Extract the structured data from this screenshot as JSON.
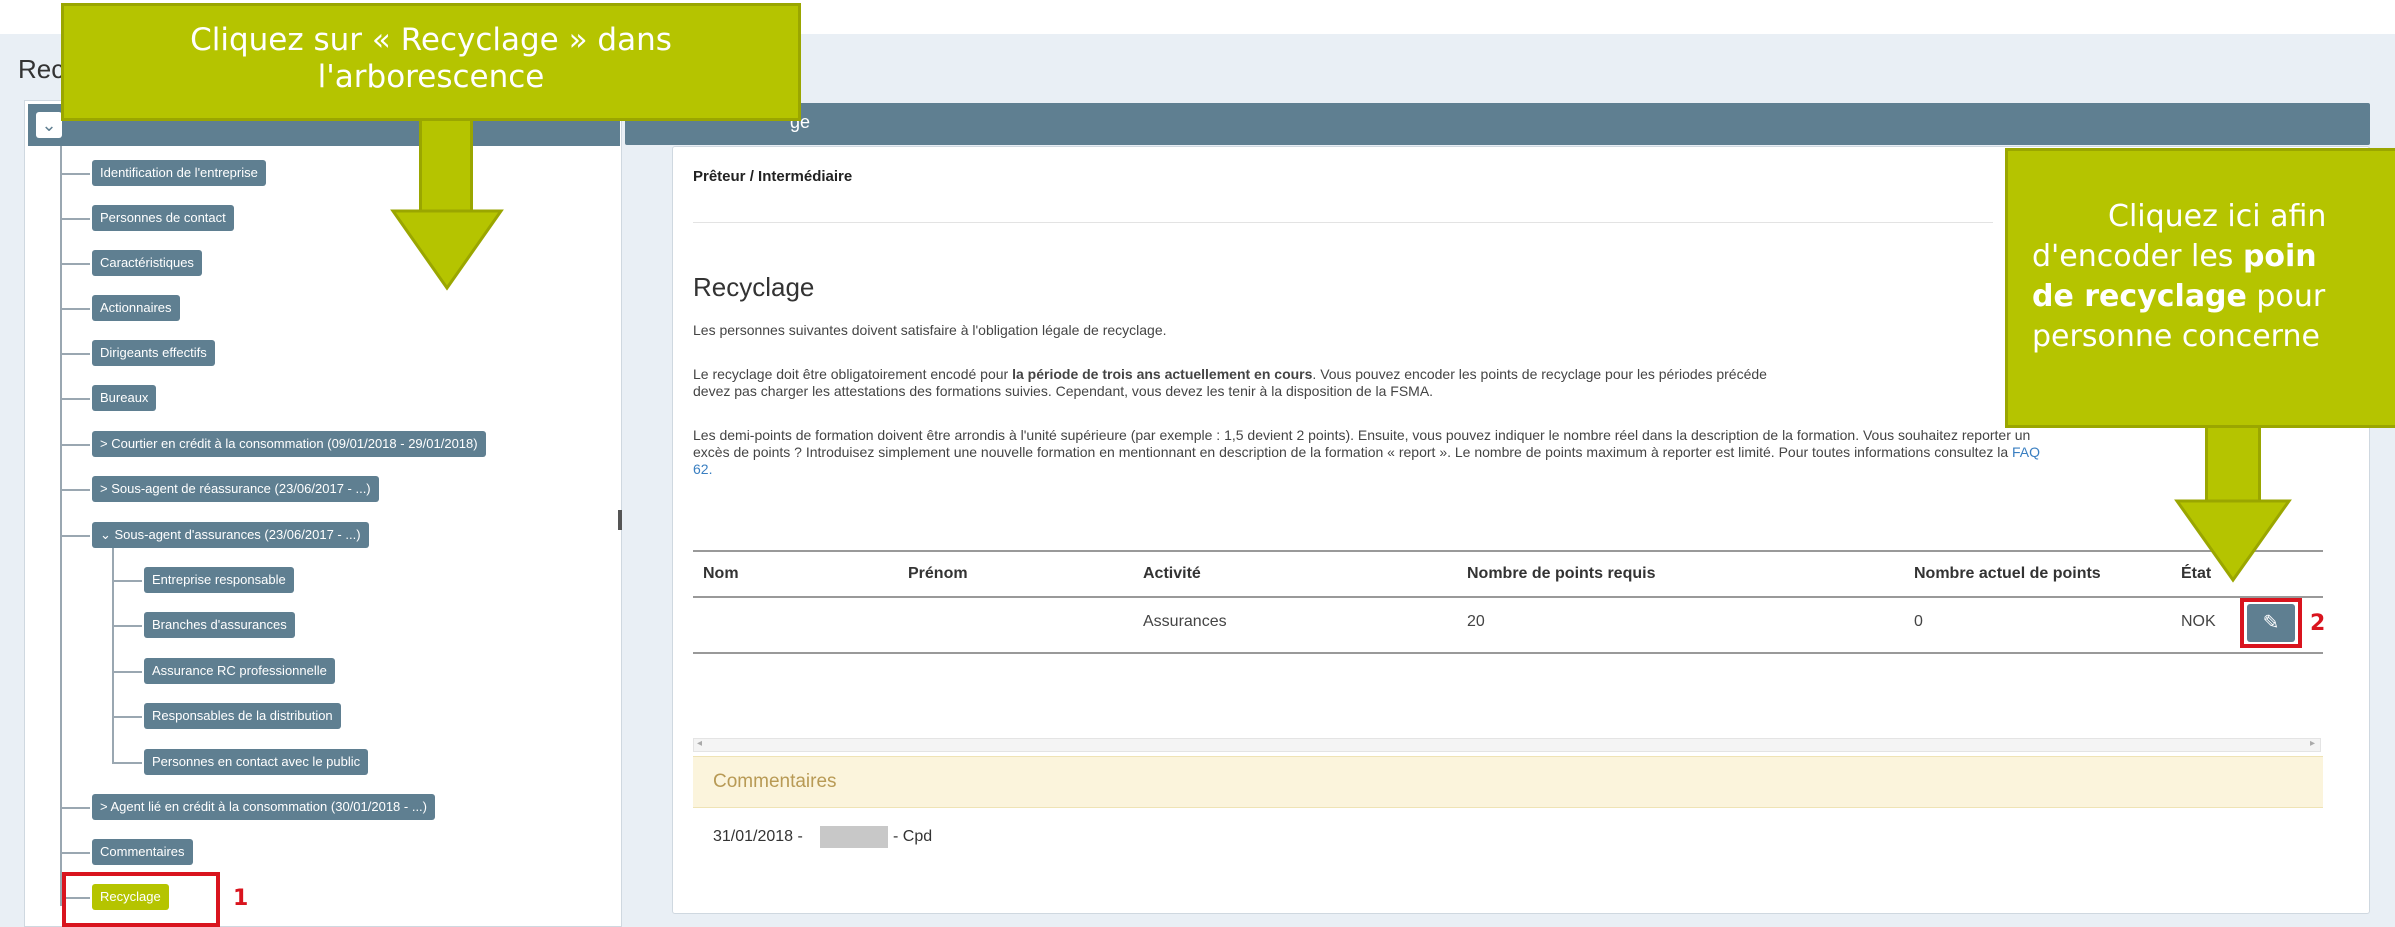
{
  "page": {
    "title": "Rec"
  },
  "tree": {
    "toggle_icon": "chevron-down-icon",
    "items": [
      {
        "label": "Identification de l'entreprise"
      },
      {
        "label": "Personnes de contact"
      },
      {
        "label": "Caractéristiques"
      },
      {
        "label": "Actionnaires"
      },
      {
        "label": "Dirigeants effectifs"
      },
      {
        "label": "Bureaux"
      },
      {
        "label": "> Courtier en crédit à la consommation (09/01/2018 - 29/01/2018)"
      },
      {
        "label": "> Sous-agent de réassurance (23/06/2017 - ...)"
      },
      {
        "label": "⌄ Sous-agent d'assurances (23/06/2017 - ...)"
      },
      {
        "label": "Entreprise responsable"
      },
      {
        "label": "Branches d'assurances"
      },
      {
        "label": "Assurance RC professionnelle"
      },
      {
        "label": "Responsables de la distribution"
      },
      {
        "label": "Personnes en contact avec le public"
      },
      {
        "label": "> Agent lié en crédit à la consommation (30/01/2018 - ...)"
      },
      {
        "label": "Commentaires"
      },
      {
        "label": "Recyclage"
      }
    ]
  },
  "main": {
    "header_title": "ge",
    "subtitle": "Prêteur / Intermédiaire",
    "section_title": "Recyclage",
    "para1": "Les personnes suivantes doivent satisfaire à l'obligation légale de recyclage.",
    "para2_a": "Le recyclage doit être obligatoirement encodé pour ",
    "para2_b": "la période de trois ans actuellement en cours",
    "para2_c": ". Vous pouvez encoder les points de recyclage pour les périodes précéde",
    "para2_line2": "devez pas charger les attestations des formations suivies. Cependant, vous devez les tenir à la disposition de la FSMA.",
    "para3_line1": "Les demi-points de formation doivent être arrondis à l'unité supérieure (par exemple : 1,5 devient 2 points). Ensuite, vous pouvez indiquer le nombre réel dans la description de la formation. Vous souhaitez reporter un",
    "para3_line2": "excès de points ? Introduisez simplement une nouvelle formation en mentionnant en description de la formation « report ». Le nombre de points maximum à reporter est limité. Pour toutes informations consultez la",
    "para3_link": "FAQ",
    "para3_line3": "62.",
    "table": {
      "headers": [
        "Nom",
        "Prénom",
        "Activité",
        "Nombre de points requis",
        "Nombre actuel de points",
        "État"
      ],
      "rows": [
        {
          "nom": "",
          "prenom": "",
          "activite": "Assurances",
          "requis": "20",
          "actuel": "0",
          "etat": "NOK"
        }
      ]
    },
    "edit_icon": "pencil-icon",
    "comments": {
      "label": "Commentaires",
      "entry_date": "31/01/2018 -",
      "entry_suffix": "- Cpd"
    }
  },
  "annotations": {
    "marker1": "1",
    "marker2": "2",
    "callout_left_line1": "Cliquez sur « Recyclage » dans",
    "callout_left_line2": "l'arborescence",
    "callout_right_line1": "Cliquez ici afin",
    "callout_right_line2_a": "d'encoder les ",
    "callout_right_line2_b": "poin",
    "callout_right_line3_a": "de recyclage",
    "callout_right_line3_b": " pour",
    "callout_right_line4": "personne concerne",
    "color": "#b5c400"
  }
}
